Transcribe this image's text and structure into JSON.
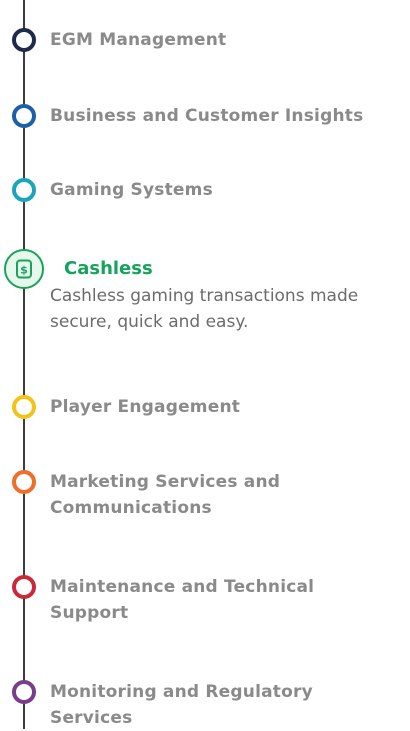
{
  "items": [
    {
      "label": "EGM Management",
      "color": "#1f2a4a"
    },
    {
      "label": "Business and Customer Insights",
      "color": "#1d5fa8"
    },
    {
      "label": "Gaming Systems",
      "color": "#1aa5b8"
    },
    {
      "label": "Cashless",
      "color": "#17a35b",
      "description": "Cashless gaming transactions made secure, quick and easy.",
      "icon": "cashless-dollar-card-icon"
    },
    {
      "label": "Player Engagement",
      "color": "#f2c318"
    },
    {
      "label": "Marketing Services and Communications",
      "color": "#ee6f2a"
    },
    {
      "label": "Maintenance and Technical Support",
      "color": "#c8293b"
    },
    {
      "label": "Monitoring and Regulatory Services",
      "color": "#7a3d8c"
    }
  ]
}
